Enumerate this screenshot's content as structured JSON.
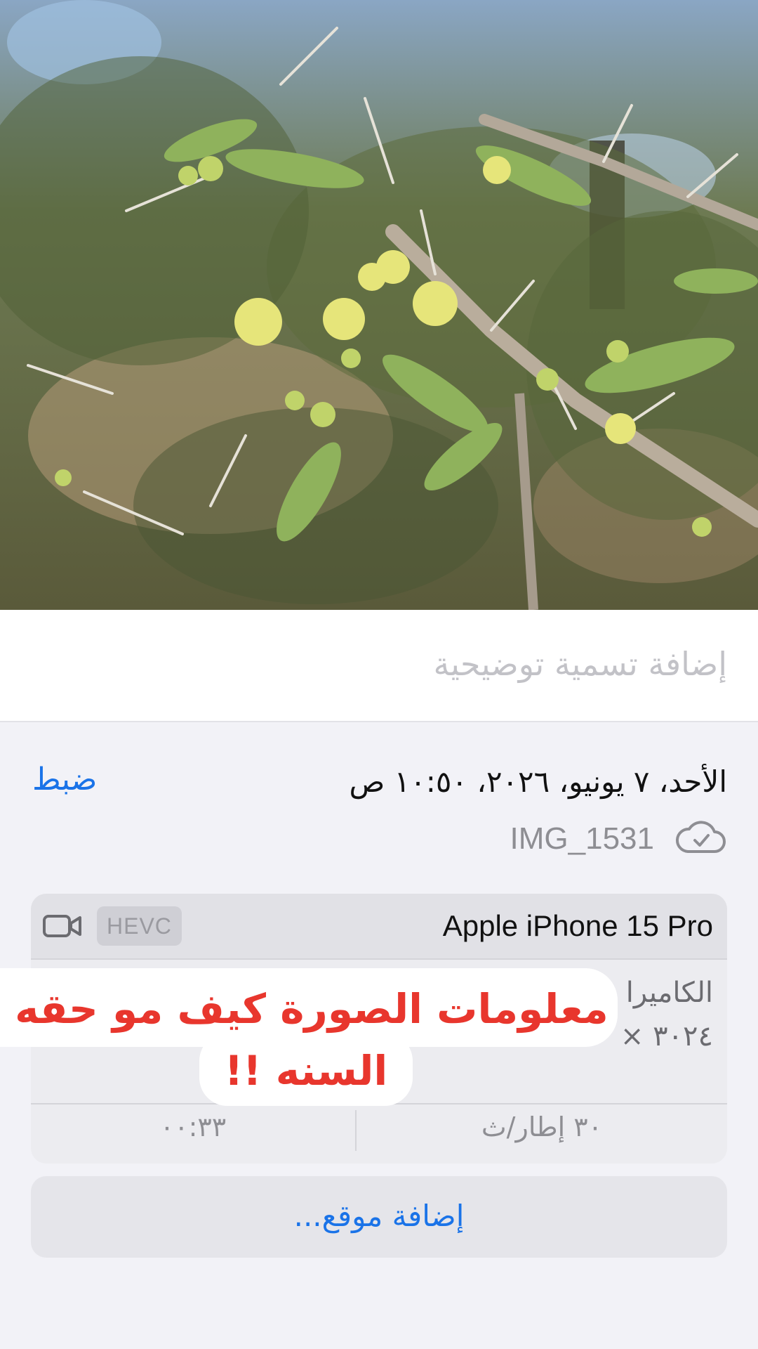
{
  "photo": {
    "subject": "flowering-acacia-branch"
  },
  "caption": {
    "placeholder": "إضافة تسمية توضيحية"
  },
  "info": {
    "date": "الأحد، ٧ يونيو، ٢٠٢٦، ١٠:٥٠ ص",
    "adjust_label": "ضبط",
    "filename": "IMG_1531",
    "cloud_icon": "icloud-check-icon"
  },
  "meta": {
    "device": "Apple iPhone 15 Pro",
    "codec": "HEVC",
    "video_icon": "video-camera-icon",
    "camera_label": "الكاميرا",
    "resolution": "٣٠٢٤ ×",
    "duration": "٠٠:٣٣",
    "fps": "٣٠ إطار/ث"
  },
  "overlay": {
    "line1": "معلومات الصورة كيف مو حقه",
    "line2": "السنه !!",
    "text_color": "#e8362d"
  },
  "location": {
    "add_label": "إضافة موقع..."
  },
  "colors": {
    "accent": "#1a73e8",
    "background": "#f2f2f7"
  }
}
